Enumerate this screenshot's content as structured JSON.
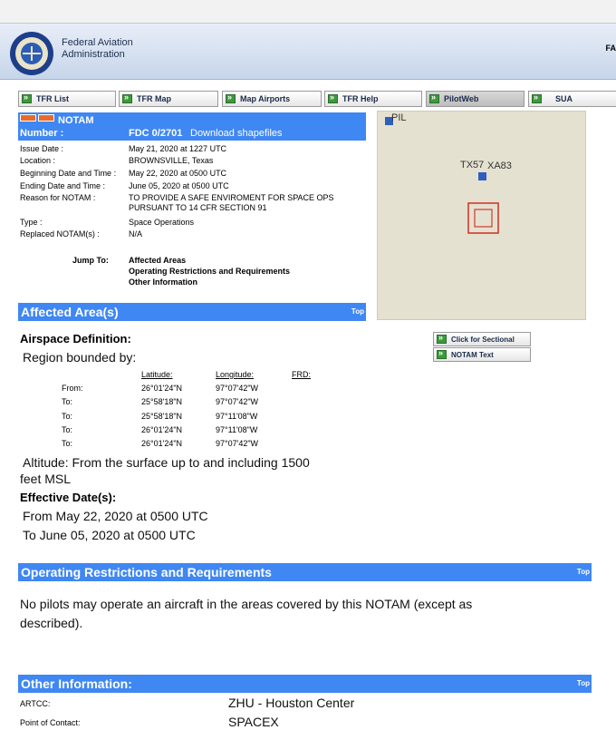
{
  "header": {
    "agency_line1": "Federal Aviation",
    "agency_line2": "Administration",
    "agency_short": "FA"
  },
  "nav": {
    "tabs": [
      {
        "label": "TFR List"
      },
      {
        "label": "TFR Map"
      },
      {
        "label": "Map Airports"
      },
      {
        "label": "TFR Help"
      },
      {
        "label": "PilotWeb"
      },
      {
        "label": "SUA"
      }
    ],
    "active": "PilotWeb"
  },
  "notam": {
    "title": "NOTAM",
    "number_label": "Number :",
    "number": "FDC 0/2701",
    "download": "Download shapefiles",
    "fields": [
      {
        "label": "Issue Date :",
        "value": "May 21, 2020 at 1227 UTC"
      },
      {
        "label": "Location :",
        "value": "BROWNSVILLE, Texas"
      },
      {
        "label": "Beginning Date and Time :",
        "value": "May 22, 2020 at 0500 UTC"
      },
      {
        "label": "Ending Date and Time :",
        "value": "June 05, 2020 at 0500 UTC"
      },
      {
        "label": "Reason for NOTAM :",
        "value": "TO PROVIDE A SAFE ENVIROMENT FOR SPACE OPS PURSUANT TO 14 CFR SECTION 91"
      },
      {
        "label": "Type :",
        "value": "Space Operations"
      },
      {
        "label": "Replaced NOTAM(s) :",
        "value": "N/A"
      }
    ],
    "jump_label": "Jump To:",
    "jump_links": [
      "Affected Areas",
      "Operating Restrictions and Requirements",
      "Other Information"
    ]
  },
  "map": {
    "label_pil": "PIL",
    "label_tx57": "TX57",
    "label_xa83": "XA83",
    "buttons": [
      "Click for Sectional",
      "NOTAM Text"
    ]
  },
  "affected": {
    "title": "Affected Area(s)",
    "top": "Top",
    "airspace_label": "Airspace Definition:",
    "region": "Region bounded by:",
    "headers": {
      "lat": "Latitude:",
      "lon": "Longitude:",
      "frd": "FRD:"
    },
    "rows": [
      {
        "label": "From:",
        "lat": "26°01'24\"N",
        "lon": "97°07'42\"W"
      },
      {
        "label": "To:",
        "lat": "25°58'18\"N",
        "lon": "97°07'42\"W"
      },
      {
        "label": "To:",
        "lat": "25°58'18\"N",
        "lon": "97°11'08\"W"
      },
      {
        "label": "To:",
        "lat": "26°01'24\"N",
        "lon": "97°11'08\"W"
      },
      {
        "label": "To:",
        "lat": "26°01'24\"N",
        "lon": "97°07'42\"W"
      }
    ],
    "altitude_line1": "Altitude: From the surface up to and including 1500",
    "altitude_line2": "feet MSL",
    "effective_label": "Effective Date(s):",
    "from": "From May 22, 2020 at 0500 UTC",
    "to": "To June 05, 2020 at 0500 UTC"
  },
  "restrictions": {
    "title": "Operating Restrictions and Requirements",
    "top": "Top",
    "text_line1": "No pilots may operate an aircraft in the areas covered by this NOTAM (except as",
    "text_line2": "described)."
  },
  "other": {
    "title": "Other Information:",
    "top": "Top",
    "artcc_label": "ARTCC:",
    "artcc": "ZHU - Houston Center",
    "poc_label": "Point of Contact:",
    "poc": "SPACEX"
  },
  "colors": {
    "accent": "#3f87f3",
    "button_green": "#3c9a3c",
    "map_bg": "#e5e1d0",
    "restriction_red": "#d33a2c"
  }
}
